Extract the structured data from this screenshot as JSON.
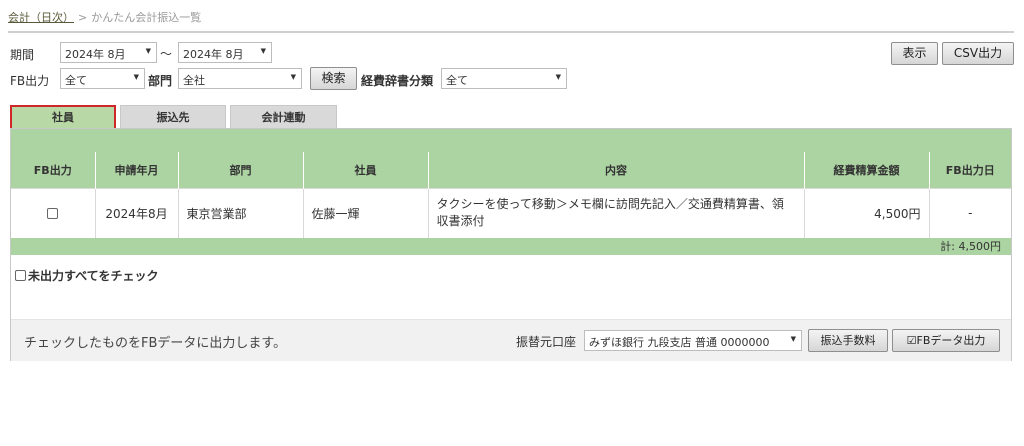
{
  "breadcrumb": {
    "parent": "会計（日次）",
    "separator": ">",
    "current": "かんたん会計振込一覧"
  },
  "filters": {
    "period_label": "期間",
    "period_from": "2024年 8月",
    "period_tilde": "～",
    "period_to": "2024年 8月",
    "fb_label": "FB出力",
    "fb_value": "全て",
    "dept_label": "部門",
    "dept_value": "全社",
    "search_button": "検索",
    "expense_cat_label": "経費辞書分類",
    "expense_cat_value": "全て"
  },
  "top_actions": {
    "show": "表示",
    "csv": "CSV出力"
  },
  "tabs": [
    {
      "label": "社員",
      "active": true
    },
    {
      "label": "振込先",
      "active": false
    },
    {
      "label": "会計連動",
      "active": false
    }
  ],
  "table": {
    "headers": [
      "FB出力",
      "申請年月",
      "部門",
      "社員",
      "内容",
      "経費精算金額",
      "FB出力日"
    ],
    "rows": [
      {
        "month": "2024年8月",
        "dept": "東京営業部",
        "employee": "佐藤一輝",
        "content": "タクシーを使って移動＞メモ欄に訪問先記入／交通費精算書、領収書添付",
        "amount": "4,500円",
        "fb_date": "-"
      }
    ],
    "total": "計: 4,500円"
  },
  "check_all_label": "未出力すべてをチェック",
  "footer": {
    "message": "チェックしたものをFBデータに出力します。",
    "account_label": "振替元口座",
    "account_value": "みずほ銀行 九段支店 普通 0000000",
    "fee_button": "振込手数料",
    "fb_button": "FBデータ出力"
  },
  "colors": {
    "header_green": "#acd3a2",
    "active_tab_border": "#d0262a"
  },
  "icons": {
    "dropdown": "triangle-down-icon",
    "fb_button": "checkbox-icon"
  }
}
